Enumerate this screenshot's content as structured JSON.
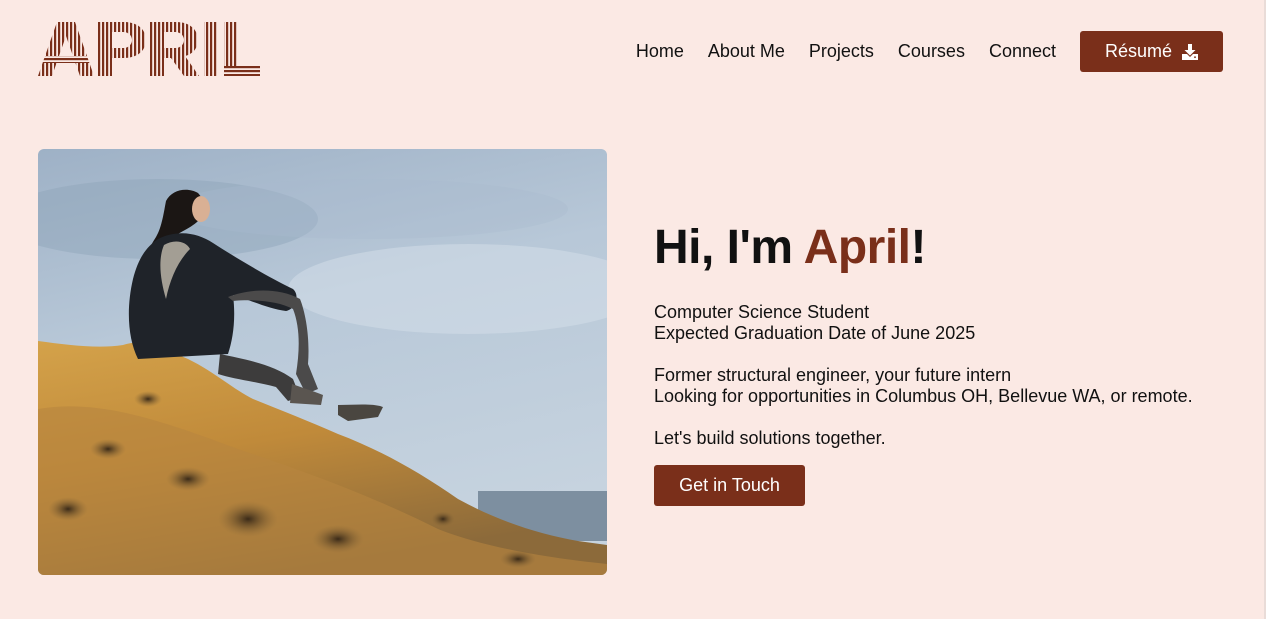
{
  "brand": {
    "logo_text": "APRIL",
    "accent_color": "#7a2f1a",
    "background_color": "#fbe9e4"
  },
  "nav": {
    "items": [
      {
        "label": "Home"
      },
      {
        "label": "About Me"
      },
      {
        "label": "Projects"
      },
      {
        "label": "Courses"
      },
      {
        "label": "Connect"
      }
    ],
    "resume_label": "Résumé",
    "resume_icon": "download-icon"
  },
  "hero": {
    "greeting_prefix": "Hi, I'm ",
    "name": "April",
    "greeting_suffix": "!",
    "lines": {
      "role": "Computer Science Student",
      "graduation": "Expected Graduation Date of June 2025",
      "background": "Former structural engineer, your future intern",
      "locations": "Looking for opportunities in Columbus OH, Bellevue WA, or remote.",
      "tagline": "Let's build solutions together."
    },
    "cta_label": "Get in Touch",
    "photo_subject": "woman-sitting-on-sandstone-cliff-photo"
  }
}
